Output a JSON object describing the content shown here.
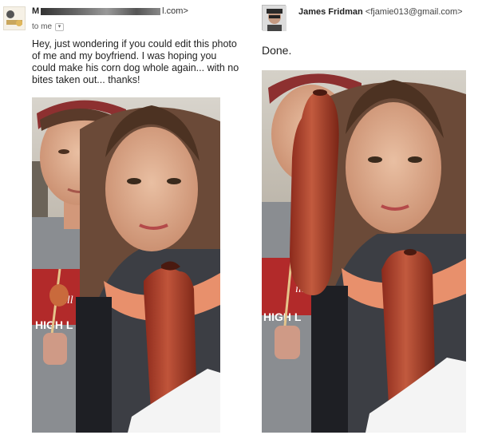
{
  "left_email": {
    "sender_prefix": "M",
    "sender_suffix": "l.com>",
    "recipient": "to me",
    "body": "Hey, just wondering if you could edit this photo of me and my boyfriend. I was hoping you could make his corn dog whole again... with no bites taken out... thanks!"
  },
  "right_email": {
    "sender_name": "James Fridman",
    "sender_email": "<fjamie013@gmail.com>",
    "body": "Done."
  },
  "photo": {
    "shirt_text": "HIGH L",
    "shirt_script": "ill"
  }
}
